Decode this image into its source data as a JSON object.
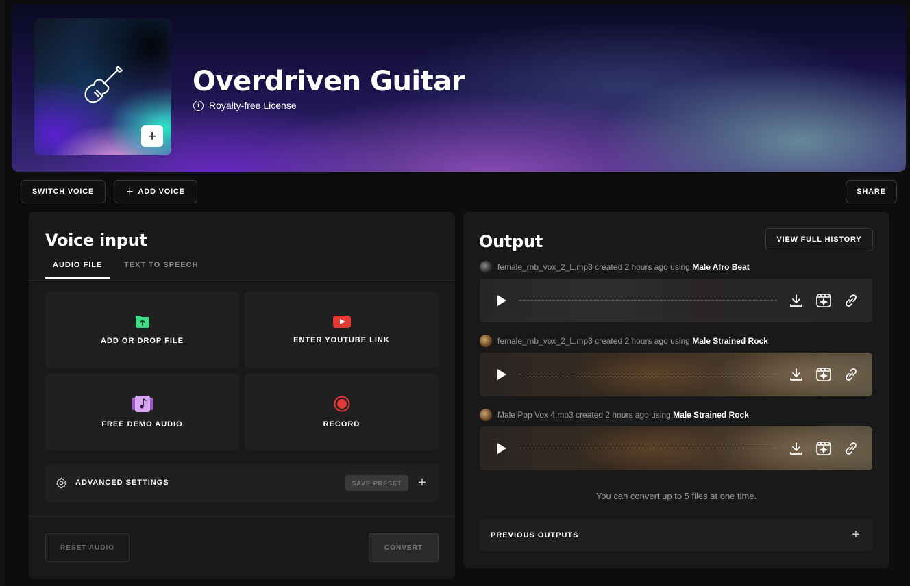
{
  "hero": {
    "title": "Overdriven Guitar",
    "license": "Royalty-free License",
    "album_add": "+"
  },
  "toolbar": {
    "switch_voice": "SWITCH VOICE",
    "add_voice": "ADD VOICE",
    "share": "SHARE"
  },
  "voice_input": {
    "title": "Voice input",
    "tabs": [
      {
        "label": "AUDIO FILE",
        "active": true
      },
      {
        "label": "TEXT TO SPEECH",
        "active": false
      }
    ],
    "tiles": [
      {
        "label": "ADD OR DROP FILE",
        "icon": "folder-upload-icon",
        "color": "#3ddc84"
      },
      {
        "label": "ENTER YOUTUBE LINK",
        "icon": "youtube-icon",
        "color": "#e53935"
      },
      {
        "label": "FREE DEMO AUDIO",
        "icon": "music-note-icon",
        "color": "#c88ae6"
      },
      {
        "label": "RECORD",
        "icon": "record-icon",
        "color": "#e53935"
      }
    ],
    "advanced_settings": "ADVANCED SETTINGS",
    "save_preset": "SAVE PRESET",
    "reset_audio": "RESET AUDIO",
    "convert": "CONVERT"
  },
  "output": {
    "title": "Output",
    "view_full_history": "VIEW FULL HISTORY",
    "items": [
      {
        "file": "female_rnb_vox_2_L.mp3 created 2 hours ago using",
        "voice": "Male Afro Beat"
      },
      {
        "file": "female_rnb_vox_2_L.mp3 created 2 hours ago using",
        "voice": "Male Strained Rock"
      },
      {
        "file": "Male Pop Vox 4.mp3 created 2 hours ago using",
        "voice": "Male Strained Rock"
      }
    ],
    "note": "You can convert up to 5 files at one time.",
    "previous_outputs": "PREVIOUS OUTPUTS"
  }
}
